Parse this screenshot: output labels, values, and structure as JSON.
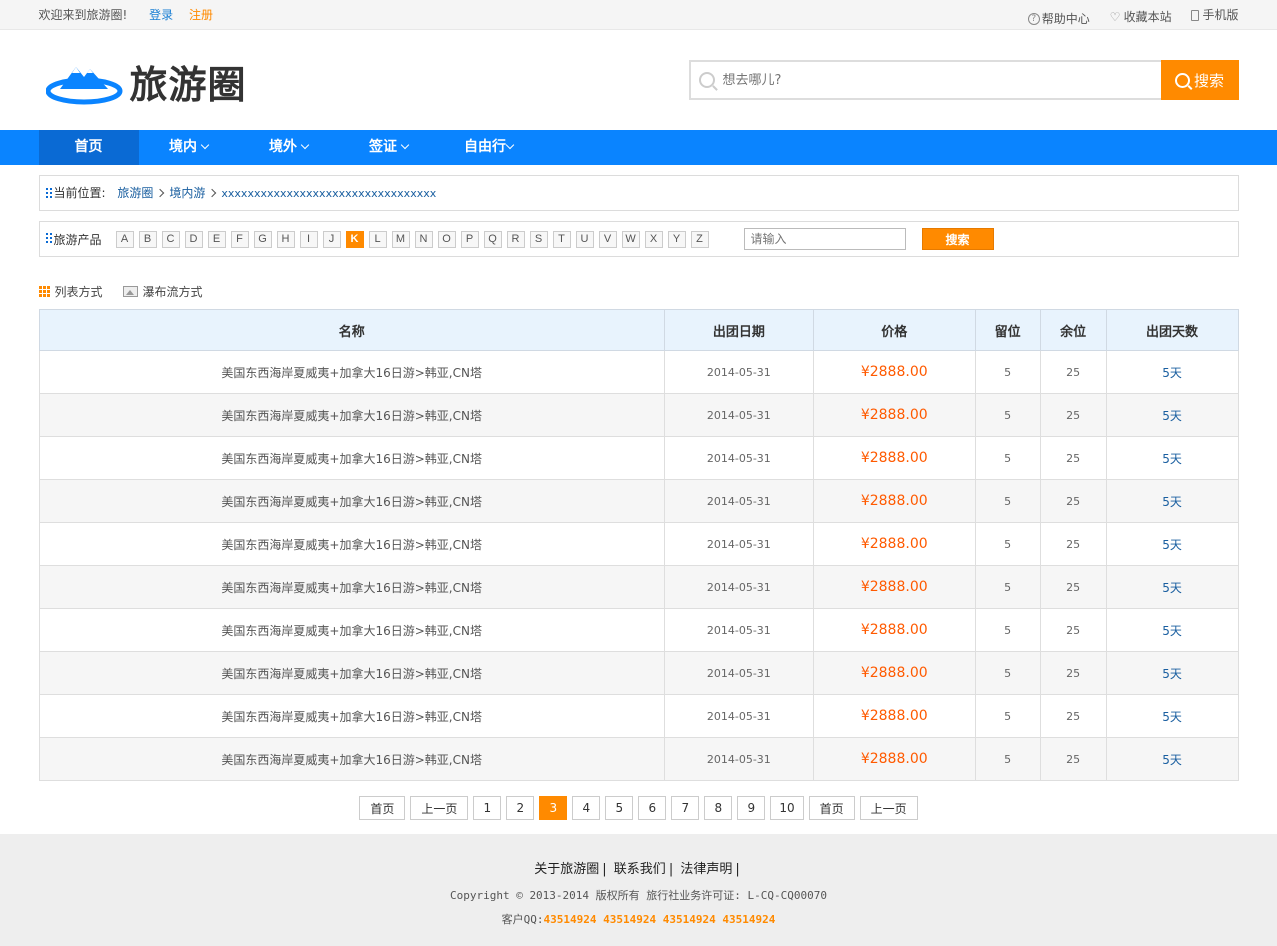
{
  "topbar": {
    "welcome": "欢迎来到旅游圈!",
    "login": "登录",
    "register": "注册",
    "help": "帮助中心",
    "favorite": "收藏本站",
    "mobile": "手机版"
  },
  "header": {
    "logo_text": "旅游圈",
    "search_placeholder": "想去哪儿?",
    "search_button": "搜索"
  },
  "nav": {
    "items": [
      {
        "label": "首页",
        "active": true,
        "dropdown": false
      },
      {
        "label": "境内",
        "active": false,
        "dropdown": true
      },
      {
        "label": "境外",
        "active": false,
        "dropdown": true
      },
      {
        "label": "签证",
        "active": false,
        "dropdown": true
      },
      {
        "label": "自由行",
        "active": false,
        "dropdown": true
      }
    ]
  },
  "breadcrumb": {
    "label": "当前位置:",
    "items": [
      "旅游圈",
      "境内游",
      "xxxxxxxxxxxxxxxxxxxxxxxxxxxxxxxxx"
    ]
  },
  "filter": {
    "label": "旅游产品",
    "letters": [
      "A",
      "B",
      "C",
      "D",
      "E",
      "F",
      "G",
      "H",
      "I",
      "J",
      "K",
      "L",
      "M",
      "N",
      "O",
      "P",
      "Q",
      "R",
      "S",
      "T",
      "U",
      "V",
      "W",
      "X",
      "Y",
      "Z"
    ],
    "active_letter": "K",
    "input_placeholder": "请输入",
    "search_button": "搜索"
  },
  "views": {
    "list": "列表方式",
    "waterfall": "瀑布流方式"
  },
  "table": {
    "headers": [
      "名称",
      "出团日期",
      "价格",
      "留位",
      "余位",
      "出团天数"
    ],
    "rows": [
      [
        "美国东西海岸夏威夷+加拿大16日游>韩亚,CN塔",
        "2014-05-31",
        "¥2888.00",
        "5",
        "25",
        "5天"
      ],
      [
        "美国东西海岸夏威夷+加拿大16日游>韩亚,CN塔",
        "2014-05-31",
        "¥2888.00",
        "5",
        "25",
        "5天"
      ],
      [
        "美国东西海岸夏威夷+加拿大16日游>韩亚,CN塔",
        "2014-05-31",
        "¥2888.00",
        "5",
        "25",
        "5天"
      ],
      [
        "美国东西海岸夏威夷+加拿大16日游>韩亚,CN塔",
        "2014-05-31",
        "¥2888.00",
        "5",
        "25",
        "5天"
      ],
      [
        "美国东西海岸夏威夷+加拿大16日游>韩亚,CN塔",
        "2014-05-31",
        "¥2888.00",
        "5",
        "25",
        "5天"
      ],
      [
        "美国东西海岸夏威夷+加拿大16日游>韩亚,CN塔",
        "2014-05-31",
        "¥2888.00",
        "5",
        "25",
        "5天"
      ],
      [
        "美国东西海岸夏威夷+加拿大16日游>韩亚,CN塔",
        "2014-05-31",
        "¥2888.00",
        "5",
        "25",
        "5天"
      ],
      [
        "美国东西海岸夏威夷+加拿大16日游>韩亚,CN塔",
        "2014-05-31",
        "¥2888.00",
        "5",
        "25",
        "5天"
      ],
      [
        "美国东西海岸夏威夷+加拿大16日游>韩亚,CN塔",
        "2014-05-31",
        "¥2888.00",
        "5",
        "25",
        "5天"
      ],
      [
        "美国东西海岸夏威夷+加拿大16日游>韩亚,CN塔",
        "2014-05-31",
        "¥2888.00",
        "5",
        "25",
        "5天"
      ]
    ]
  },
  "pager": {
    "items": [
      "首页",
      "上一页",
      "1",
      "2",
      "3",
      "4",
      "5",
      "6",
      "7",
      "8",
      "9",
      "10",
      "首页",
      "上一页"
    ],
    "active": "3"
  },
  "footer": {
    "links": [
      "关于旅游圈",
      "联系我们",
      "法律声明"
    ],
    "copyright": "Copyright © 2013-2014 版权所有 旅行社业务许可证: L-CQ-CQ00070",
    "qq_label": "客户QQ:",
    "qq_numbers": "43514924 43514924 43514924 43514924"
  },
  "colors": {
    "accent": "#ff8a00",
    "nav": "#0a84ff",
    "nav_active": "#0a6ad4",
    "price": "#ff5a00"
  }
}
